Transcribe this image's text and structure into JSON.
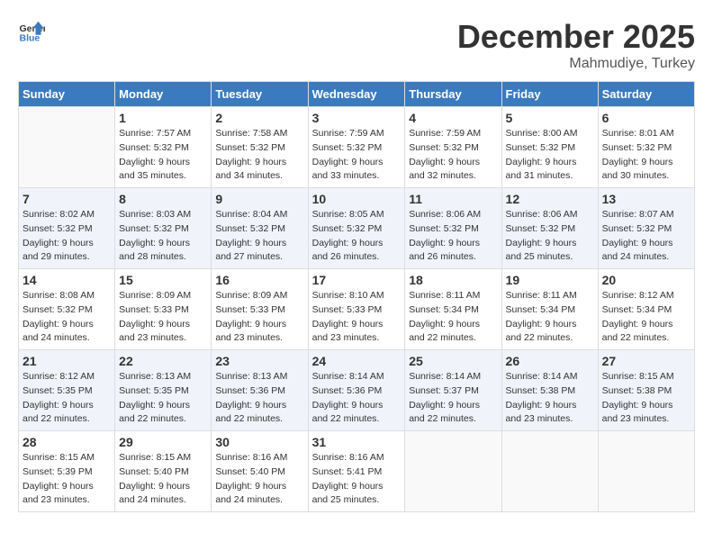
{
  "header": {
    "logo_line1": "General",
    "logo_line2": "Blue",
    "month_year": "December 2025",
    "location": "Mahmudiye, Turkey"
  },
  "weekdays": [
    "Sunday",
    "Monday",
    "Tuesday",
    "Wednesday",
    "Thursday",
    "Friday",
    "Saturday"
  ],
  "weeks": [
    [
      {
        "day": "",
        "sunrise": "",
        "sunset": "",
        "daylight": ""
      },
      {
        "day": "1",
        "sunrise": "Sunrise: 7:57 AM",
        "sunset": "Sunset: 5:32 PM",
        "daylight": "Daylight: 9 hours and 35 minutes."
      },
      {
        "day": "2",
        "sunrise": "Sunrise: 7:58 AM",
        "sunset": "Sunset: 5:32 PM",
        "daylight": "Daylight: 9 hours and 34 minutes."
      },
      {
        "day": "3",
        "sunrise": "Sunrise: 7:59 AM",
        "sunset": "Sunset: 5:32 PM",
        "daylight": "Daylight: 9 hours and 33 minutes."
      },
      {
        "day": "4",
        "sunrise": "Sunrise: 7:59 AM",
        "sunset": "Sunset: 5:32 PM",
        "daylight": "Daylight: 9 hours and 32 minutes."
      },
      {
        "day": "5",
        "sunrise": "Sunrise: 8:00 AM",
        "sunset": "Sunset: 5:32 PM",
        "daylight": "Daylight: 9 hours and 31 minutes."
      },
      {
        "day": "6",
        "sunrise": "Sunrise: 8:01 AM",
        "sunset": "Sunset: 5:32 PM",
        "daylight": "Daylight: 9 hours and 30 minutes."
      }
    ],
    [
      {
        "day": "7",
        "sunrise": "Sunrise: 8:02 AM",
        "sunset": "Sunset: 5:32 PM",
        "daylight": "Daylight: 9 hours and 29 minutes."
      },
      {
        "day": "8",
        "sunrise": "Sunrise: 8:03 AM",
        "sunset": "Sunset: 5:32 PM",
        "daylight": "Daylight: 9 hours and 28 minutes."
      },
      {
        "day": "9",
        "sunrise": "Sunrise: 8:04 AM",
        "sunset": "Sunset: 5:32 PM",
        "daylight": "Daylight: 9 hours and 27 minutes."
      },
      {
        "day": "10",
        "sunrise": "Sunrise: 8:05 AM",
        "sunset": "Sunset: 5:32 PM",
        "daylight": "Daylight: 9 hours and 26 minutes."
      },
      {
        "day": "11",
        "sunrise": "Sunrise: 8:06 AM",
        "sunset": "Sunset: 5:32 PM",
        "daylight": "Daylight: 9 hours and 26 minutes."
      },
      {
        "day": "12",
        "sunrise": "Sunrise: 8:06 AM",
        "sunset": "Sunset: 5:32 PM",
        "daylight": "Daylight: 9 hours and 25 minutes."
      },
      {
        "day": "13",
        "sunrise": "Sunrise: 8:07 AM",
        "sunset": "Sunset: 5:32 PM",
        "daylight": "Daylight: 9 hours and 24 minutes."
      }
    ],
    [
      {
        "day": "14",
        "sunrise": "Sunrise: 8:08 AM",
        "sunset": "Sunset: 5:32 PM",
        "daylight": "Daylight: 9 hours and 24 minutes."
      },
      {
        "day": "15",
        "sunrise": "Sunrise: 8:09 AM",
        "sunset": "Sunset: 5:33 PM",
        "daylight": "Daylight: 9 hours and 23 minutes."
      },
      {
        "day": "16",
        "sunrise": "Sunrise: 8:09 AM",
        "sunset": "Sunset: 5:33 PM",
        "daylight": "Daylight: 9 hours and 23 minutes."
      },
      {
        "day": "17",
        "sunrise": "Sunrise: 8:10 AM",
        "sunset": "Sunset: 5:33 PM",
        "daylight": "Daylight: 9 hours and 23 minutes."
      },
      {
        "day": "18",
        "sunrise": "Sunrise: 8:11 AM",
        "sunset": "Sunset: 5:34 PM",
        "daylight": "Daylight: 9 hours and 22 minutes."
      },
      {
        "day": "19",
        "sunrise": "Sunrise: 8:11 AM",
        "sunset": "Sunset: 5:34 PM",
        "daylight": "Daylight: 9 hours and 22 minutes."
      },
      {
        "day": "20",
        "sunrise": "Sunrise: 8:12 AM",
        "sunset": "Sunset: 5:34 PM",
        "daylight": "Daylight: 9 hours and 22 minutes."
      }
    ],
    [
      {
        "day": "21",
        "sunrise": "Sunrise: 8:12 AM",
        "sunset": "Sunset: 5:35 PM",
        "daylight": "Daylight: 9 hours and 22 minutes."
      },
      {
        "day": "22",
        "sunrise": "Sunrise: 8:13 AM",
        "sunset": "Sunset: 5:35 PM",
        "daylight": "Daylight: 9 hours and 22 minutes."
      },
      {
        "day": "23",
        "sunrise": "Sunrise: 8:13 AM",
        "sunset": "Sunset: 5:36 PM",
        "daylight": "Daylight: 9 hours and 22 minutes."
      },
      {
        "day": "24",
        "sunrise": "Sunrise: 8:14 AM",
        "sunset": "Sunset: 5:36 PM",
        "daylight": "Daylight: 9 hours and 22 minutes."
      },
      {
        "day": "25",
        "sunrise": "Sunrise: 8:14 AM",
        "sunset": "Sunset: 5:37 PM",
        "daylight": "Daylight: 9 hours and 22 minutes."
      },
      {
        "day": "26",
        "sunrise": "Sunrise: 8:14 AM",
        "sunset": "Sunset: 5:38 PM",
        "daylight": "Daylight: 9 hours and 23 minutes."
      },
      {
        "day": "27",
        "sunrise": "Sunrise: 8:15 AM",
        "sunset": "Sunset: 5:38 PM",
        "daylight": "Daylight: 9 hours and 23 minutes."
      }
    ],
    [
      {
        "day": "28",
        "sunrise": "Sunrise: 8:15 AM",
        "sunset": "Sunset: 5:39 PM",
        "daylight": "Daylight: 9 hours and 23 minutes."
      },
      {
        "day": "29",
        "sunrise": "Sunrise: 8:15 AM",
        "sunset": "Sunset: 5:40 PM",
        "daylight": "Daylight: 9 hours and 24 minutes."
      },
      {
        "day": "30",
        "sunrise": "Sunrise: 8:16 AM",
        "sunset": "Sunset: 5:40 PM",
        "daylight": "Daylight: 9 hours and 24 minutes."
      },
      {
        "day": "31",
        "sunrise": "Sunrise: 8:16 AM",
        "sunset": "Sunset: 5:41 PM",
        "daylight": "Daylight: 9 hours and 25 minutes."
      },
      {
        "day": "",
        "sunrise": "",
        "sunset": "",
        "daylight": ""
      },
      {
        "day": "",
        "sunrise": "",
        "sunset": "",
        "daylight": ""
      },
      {
        "day": "",
        "sunrise": "",
        "sunset": "",
        "daylight": ""
      }
    ]
  ]
}
